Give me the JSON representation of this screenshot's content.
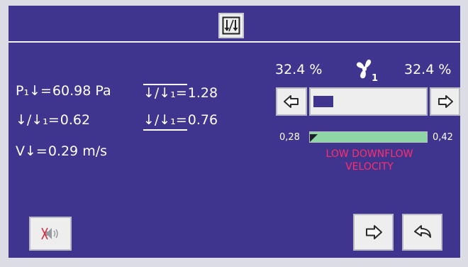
{
  "header": {
    "mode_icon": "downflow-ratio-icon"
  },
  "readings": {
    "pressure": {
      "symbol": "P₁↓=",
      "value": "60.98 Pa"
    },
    "ratio_a": {
      "symbol": "↓/↓₁=",
      "value": "0.62"
    },
    "velocity": {
      "symbol": "V↓=",
      "value": "0.29 m/s"
    },
    "ratio_max": {
      "symbol": "↓/↓₁=",
      "value": "1.28"
    },
    "ratio_min": {
      "symbol": "↓/↓₁=",
      "value": "0.76"
    }
  },
  "fan": {
    "left_percent": "32.4 %",
    "right_percent": "32.4 %",
    "icon": "fan-1-icon",
    "level_percent": 32.4
  },
  "velocity_range": {
    "min_label": "0,28",
    "max_label": "0,42"
  },
  "warning": {
    "line1": "LOW DOWNFLOW",
    "line2": "VELOCITY"
  },
  "buttons": {
    "decrease_icon": "arrow-left-icon",
    "increase_icon": "arrow-right-icon",
    "mute_icon": "alarm-mute-icon",
    "next_icon": "arrow-right-icon",
    "back_icon": "return-arrow-icon"
  },
  "colors": {
    "background": "#3f348e",
    "button": "#eeeeee",
    "range_ok": "#8fd6a6",
    "warning": "#ff2f6e"
  }
}
